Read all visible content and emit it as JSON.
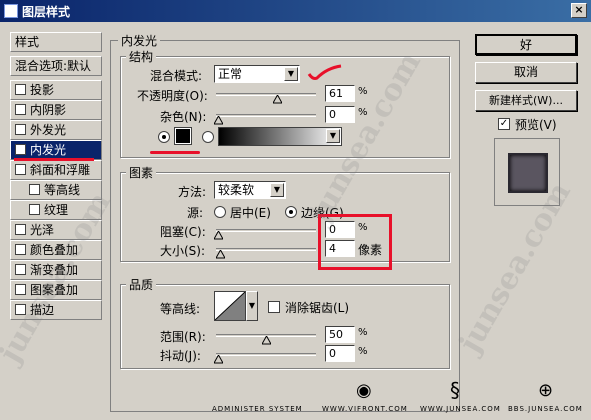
{
  "window": {
    "title": "图层样式",
    "close": "×"
  },
  "sidebar": {
    "header": "样式",
    "blend_options": "混合选项:默认",
    "items": [
      {
        "label": "投影",
        "checked": false
      },
      {
        "label": "内阴影",
        "checked": false
      },
      {
        "label": "外发光",
        "checked": false
      },
      {
        "label": "内发光",
        "checked": true
      },
      {
        "label": "斜面和浮雕",
        "checked": false
      },
      {
        "label": "等高线",
        "checked": false
      },
      {
        "label": "纹理",
        "checked": false
      },
      {
        "label": "光泽",
        "checked": false
      },
      {
        "label": "颜色叠加",
        "checked": false
      },
      {
        "label": "渐变叠加",
        "checked": false
      },
      {
        "label": "图案叠加",
        "checked": false
      },
      {
        "label": "描边",
        "checked": false
      }
    ]
  },
  "panel": {
    "title": "内发光",
    "structure": {
      "title": "结构",
      "blend_mode_label": "混合模式:",
      "blend_mode_value": "正常",
      "opacity_label": "不透明度(O):",
      "opacity_value": "61",
      "opacity_level": 0.61,
      "noise_label": "杂色(N):",
      "noise_value": "0",
      "percent": "%",
      "color": "#000000",
      "color_selected": true
    },
    "elements": {
      "title": "图素",
      "method_label": "方法:",
      "method_value": "较柔软",
      "source_label": "源:",
      "source_center": "居中(E)",
      "source_edge": "边缘(G)",
      "source_selected": "edge",
      "choke_label": "阻塞(C):",
      "choke_value": "0",
      "size_label": "大小(S):",
      "size_value": "4",
      "px_unit": "像素"
    },
    "quality": {
      "title": "品质",
      "contour_label": "等高线:",
      "antialias_label": "消除锯齿(L)",
      "range_label": "范围(R):",
      "range_value": "50",
      "range_level": 0.5,
      "jitter_label": "抖动(J):",
      "jitter_value": "0"
    }
  },
  "buttons": {
    "ok": "好",
    "cancel": "取消",
    "new_style": "新建样式(W)...",
    "preview": "预览(V)"
  },
  "footer": {
    "logo1": "ADMINISTER SYSTEM",
    "logo2": "WWW.VIFRONT.COM",
    "logo3": "WWW.JUNSEA.COM",
    "logo4": "BBS.JUNSEA.COM"
  },
  "watermark": "junsea.com",
  "colors": {
    "accent": "#0a246a",
    "annotation": "#e8102a"
  }
}
